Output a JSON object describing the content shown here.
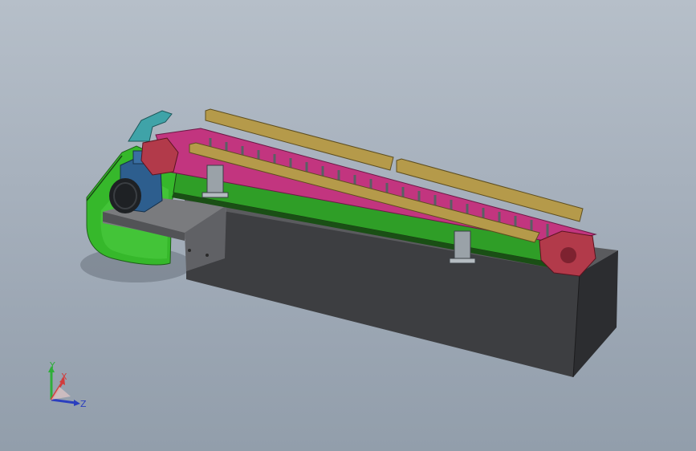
{
  "viewport": {
    "background_top": "#b6bfc9",
    "background_bottom": "#929eab"
  },
  "model": {
    "description_visible": false,
    "parts": [
      "base-block",
      "drive-housing",
      "motor",
      "mounting-plate",
      "conveyor-chain",
      "guide-rails",
      "support-brackets",
      "sprocket-ends"
    ],
    "colors": {
      "base": "#3f4043",
      "housing": "#35b52a",
      "chain": "#c2357f",
      "rails": "#b59a4a",
      "motor": "#2d5e8e",
      "plate": "#6b6b6b",
      "bracket": "#9aa2a8",
      "sprocket": "#b23a4a",
      "guard": "#3fa3a8"
    }
  },
  "triad": {
    "x_label": "X",
    "y_label": "Y",
    "z_label": "Z",
    "x_color": "#d23c3c",
    "y_color": "#2fae3a",
    "z_color": "#2b3fbf"
  }
}
